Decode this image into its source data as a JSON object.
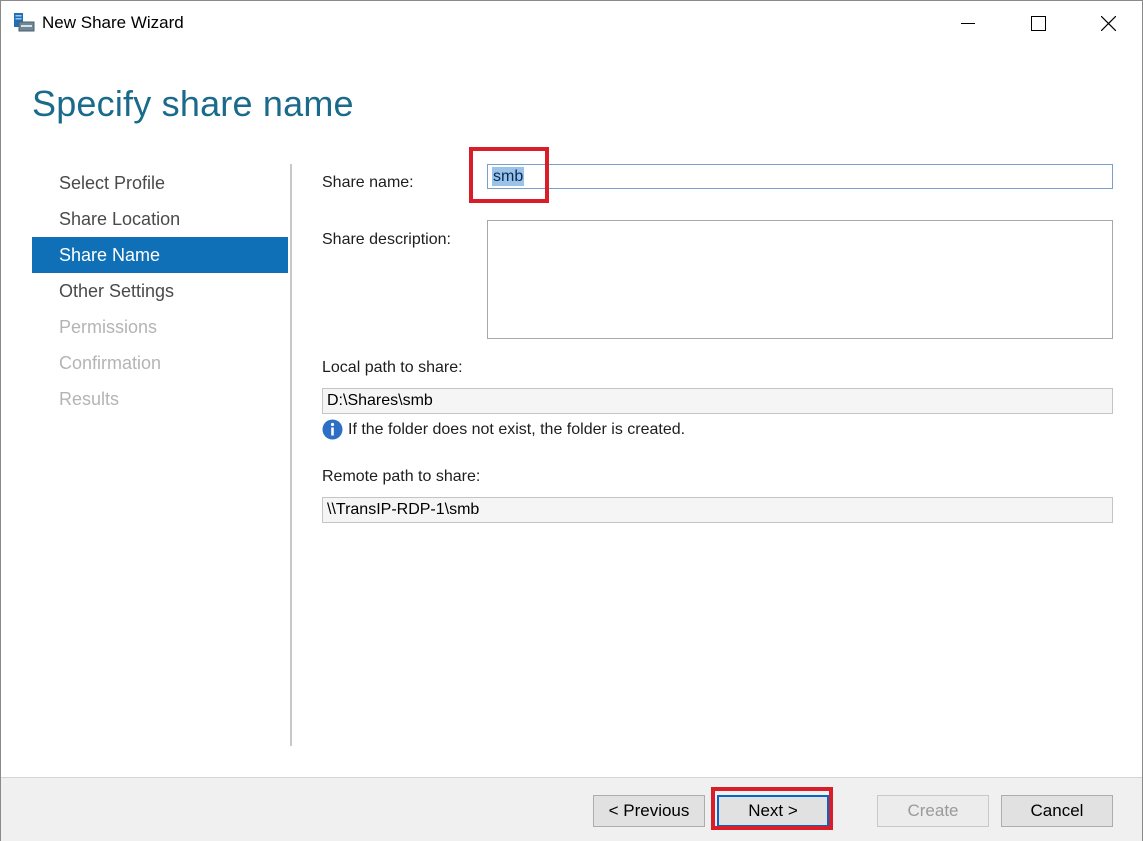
{
  "window": {
    "title": "New Share Wizard",
    "icon": "server-share-icon"
  },
  "page": {
    "heading": "Specify share name"
  },
  "nav": {
    "items": [
      {
        "label": "Select Profile",
        "state": "normal"
      },
      {
        "label": "Share Location",
        "state": "normal"
      },
      {
        "label": "Share Name",
        "state": "active"
      },
      {
        "label": "Other Settings",
        "state": "normal"
      },
      {
        "label": "Permissions",
        "state": "disabled"
      },
      {
        "label": "Confirmation",
        "state": "disabled"
      },
      {
        "label": "Results",
        "state": "disabled"
      }
    ]
  },
  "form": {
    "share_name_label": "Share name:",
    "share_name_value": "smb",
    "share_desc_label": "Share description:",
    "share_desc_value": "",
    "local_path_label": "Local path to share:",
    "local_path_value": "D:\\Shares\\smb",
    "info_text": "If the folder does not exist, the folder is created.",
    "remote_path_label": "Remote path to share:",
    "remote_path_value": "\\\\TransIP-RDP-1\\smb"
  },
  "buttons": {
    "previous": "< Previous",
    "next": "Next >",
    "create": "Create",
    "cancel": "Cancel"
  },
  "colors": {
    "accent": "#0f70b7",
    "heading": "#1a6a8c",
    "highlight_box": "#d81e28"
  }
}
